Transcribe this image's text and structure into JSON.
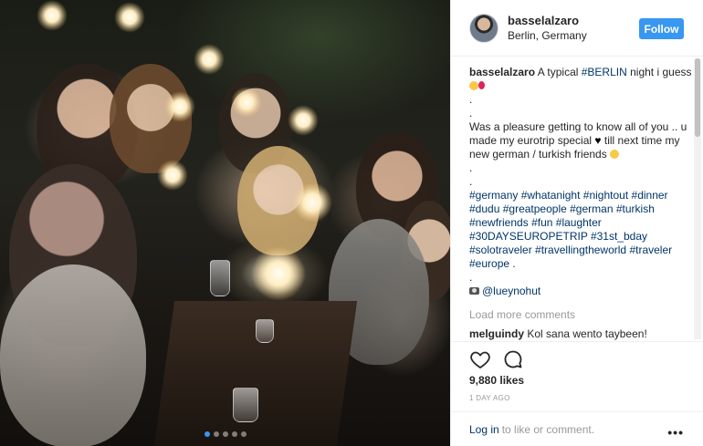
{
  "post": {
    "username": "basselalzaro",
    "location": "Berlin, Germany",
    "follow_label": "Follow",
    "caption_intro": "A typical ",
    "caption_berlin_tag": "#BERLIN",
    "caption_night": " night i guess",
    "caption_body": ".\n.\nWas a pleasure getting to know all of you .. u made my eurotrip special",
    "caption_body_2": " till next time my new german / turkish friends",
    "caption_dots": ".\n.",
    "hashtags": [
      "#germany",
      "#whatanight",
      "#nightout",
      "#dinner",
      "#dudu",
      "#greatpeople",
      "#german",
      "#turkish",
      "#newfriends",
      "#fun",
      "#laughter",
      "#30DAYSEUROPETRIP",
      "#31st_bday",
      "#solotraveler",
      "#travellingtheworld",
      "#traveler",
      "#europe"
    ],
    "hashtags_end": " .",
    "caption_dot_after": ".",
    "photo_credit": "@lueynohut",
    "load_more": "Load more comments",
    "comment": {
      "user": "melguindy",
      "text": "Kol sana wento taybeen!"
    },
    "likes": "9,880 likes",
    "time": "1 DAY AGO",
    "login_link": "Log in",
    "login_suffix": "to like or comment.",
    "more_label": "•••"
  },
  "icons": {
    "like": "heart-outline-icon",
    "comment": "speech-bubble-icon",
    "more": "ellipsis-icon",
    "camera": "camera-icon"
  },
  "colors": {
    "accent": "#3897f0",
    "link": "#003569",
    "muted": "#999999",
    "text": "#262626"
  },
  "carousel": {
    "total": 5,
    "active": 1
  }
}
